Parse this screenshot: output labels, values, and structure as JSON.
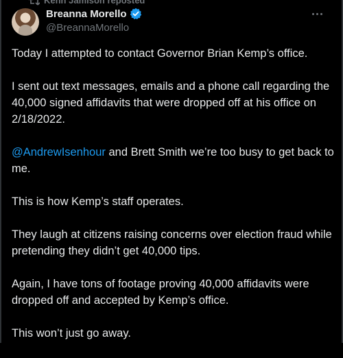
{
  "repost": {
    "text": "Kehn Jamison reposted"
  },
  "author": {
    "display_name": "Breanna Morello",
    "handle": "@BreannaMorello",
    "verified": true
  },
  "icons": {
    "repost": "repost-icon",
    "verified": "verified-badge-icon",
    "more": "more-options-icon",
    "avatar": "avatar"
  },
  "colors": {
    "background": "#000000",
    "text": "#e7e9ea",
    "muted": "#71767b",
    "link": "#1d9bf0",
    "verified": "#1d9bf0"
  },
  "tweet": {
    "p1": "Today I attempted to contact Governor Brian Kemp’s office.",
    "p2": "I sent out text messages, emails and a phone call regarding the 40,000 signed affidavits that were dropped off at his office on 2/18/2022.",
    "p3_mention": "@AndrewIsenhour",
    "p3_rest": " and Brett Smith we’re too busy to get back to me.",
    "p4": "This is how Kemp’s staff operates.",
    "p5": "They laugh at citizens raising concerns over election fraud while pretending they didn’t get 40,000 tips.",
    "p6": "Again, I have tons of footage proving 40,000 affidavits were dropped off and accepted by Kemp’s office.",
    "p7": "This won’t just go away."
  }
}
